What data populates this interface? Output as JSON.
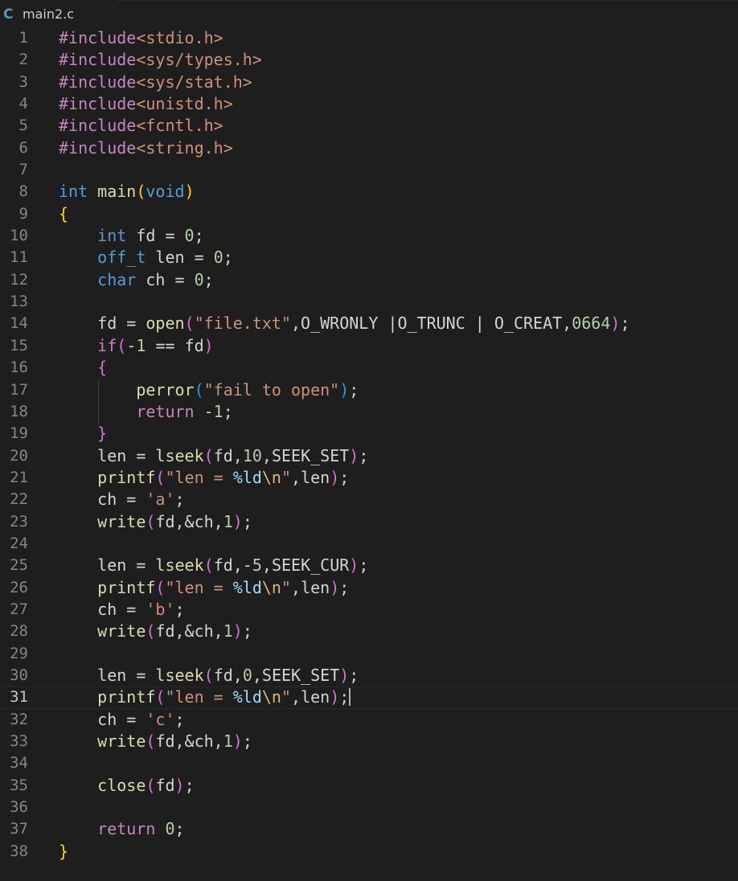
{
  "tab": {
    "icon": "C",
    "filename": "main2.c"
  },
  "editor": {
    "current_line": 31
  },
  "code_lines": [
    {
      "n": "1",
      "tokens": [
        [
          "ctl",
          "#include"
        ],
        [
          "str",
          "<stdio.h>"
        ]
      ]
    },
    {
      "n": "2",
      "tokens": [
        [
          "ctl",
          "#include"
        ],
        [
          "str",
          "<sys/types.h>"
        ]
      ]
    },
    {
      "n": "3",
      "tokens": [
        [
          "ctl",
          "#include"
        ],
        [
          "str",
          "<sys/stat.h>"
        ]
      ]
    },
    {
      "n": "4",
      "tokens": [
        [
          "ctl",
          "#include"
        ],
        [
          "str",
          "<unistd.h>"
        ]
      ]
    },
    {
      "n": "5",
      "tokens": [
        [
          "ctl",
          "#include"
        ],
        [
          "str",
          "<fcntl.h>"
        ]
      ]
    },
    {
      "n": "6",
      "tokens": [
        [
          "ctl",
          "#include"
        ],
        [
          "str",
          "<string.h>"
        ]
      ]
    },
    {
      "n": "7",
      "tokens": []
    },
    {
      "n": "8",
      "tokens": [
        [
          "kw",
          "int"
        ],
        [
          "p",
          " "
        ],
        [
          "fn",
          "main"
        ],
        [
          "br1",
          "("
        ],
        [
          "kw",
          "void"
        ],
        [
          "br1",
          ")"
        ]
      ]
    },
    {
      "n": "9",
      "tokens": [
        [
          "br1",
          "{"
        ]
      ]
    },
    {
      "n": "10",
      "tokens": [
        [
          "p",
          "    "
        ],
        [
          "kw",
          "int"
        ],
        [
          "p",
          " fd = "
        ],
        [
          "num",
          "0"
        ],
        [
          "p",
          ";"
        ]
      ]
    },
    {
      "n": "11",
      "tokens": [
        [
          "p",
          "    "
        ],
        [
          "kw",
          "off_t"
        ],
        [
          "p",
          " len = "
        ],
        [
          "num",
          "0"
        ],
        [
          "p",
          ";"
        ]
      ]
    },
    {
      "n": "12",
      "tokens": [
        [
          "p",
          "    "
        ],
        [
          "kw",
          "char"
        ],
        [
          "p",
          " ch = "
        ],
        [
          "num",
          "0"
        ],
        [
          "p",
          ";"
        ]
      ]
    },
    {
      "n": "13",
      "tokens": []
    },
    {
      "n": "14",
      "tokens": [
        [
          "p",
          "    fd = "
        ],
        [
          "fn",
          "open"
        ],
        [
          "br2",
          "("
        ],
        [
          "str",
          "\"file.txt\""
        ],
        [
          "p",
          ",O_WRONLY |O_TRUNC | O_CREAT,"
        ],
        [
          "num",
          "0664"
        ],
        [
          "br2",
          ")"
        ],
        [
          "p",
          ";"
        ]
      ]
    },
    {
      "n": "15",
      "tokens": [
        [
          "p",
          "    "
        ],
        [
          "ctl",
          "if"
        ],
        [
          "br2",
          "("
        ],
        [
          "p",
          "-"
        ],
        [
          "num",
          "1"
        ],
        [
          "p",
          " == fd"
        ],
        [
          "br2",
          ")"
        ]
      ]
    },
    {
      "n": "16",
      "tokens": [
        [
          "p",
          "    "
        ],
        [
          "br2",
          "{"
        ]
      ]
    },
    {
      "n": "17",
      "tokens": [
        [
          "p",
          "        "
        ],
        [
          "fn",
          "perror"
        ],
        [
          "br3",
          "("
        ],
        [
          "str",
          "\"fail to open\""
        ],
        [
          "br3",
          ")"
        ],
        [
          "p",
          ";"
        ]
      ]
    },
    {
      "n": "18",
      "tokens": [
        [
          "p",
          "        "
        ],
        [
          "ctl",
          "return"
        ],
        [
          "p",
          " -"
        ],
        [
          "num",
          "1"
        ],
        [
          "p",
          ";"
        ]
      ]
    },
    {
      "n": "19",
      "tokens": [
        [
          "p",
          "    "
        ],
        [
          "br2",
          "}"
        ]
      ]
    },
    {
      "n": "20",
      "tokens": [
        [
          "p",
          "    len = "
        ],
        [
          "fn",
          "lseek"
        ],
        [
          "br2",
          "("
        ],
        [
          "p",
          "fd,"
        ],
        [
          "num",
          "10"
        ],
        [
          "p",
          ",SEEK_SET"
        ],
        [
          "br2",
          ")"
        ],
        [
          "p",
          ";"
        ]
      ]
    },
    {
      "n": "21",
      "tokens": [
        [
          "p",
          "    "
        ],
        [
          "fn",
          "printf"
        ],
        [
          "br2",
          "("
        ],
        [
          "str",
          "\"len = "
        ],
        [
          "fmt",
          "%ld"
        ],
        [
          "esc",
          "\\n"
        ],
        [
          "str",
          "\""
        ],
        [
          "p",
          ",len"
        ],
        [
          "br2",
          ")"
        ],
        [
          "p",
          ";"
        ]
      ]
    },
    {
      "n": "22",
      "tokens": [
        [
          "p",
          "    ch = "
        ],
        [
          "str",
          "'a'"
        ],
        [
          "p",
          ";"
        ]
      ]
    },
    {
      "n": "23",
      "tokens": [
        [
          "p",
          "    "
        ],
        [
          "fn",
          "write"
        ],
        [
          "br2",
          "("
        ],
        [
          "p",
          "fd,&ch,"
        ],
        [
          "num",
          "1"
        ],
        [
          "br2",
          ")"
        ],
        [
          "p",
          ";"
        ]
      ]
    },
    {
      "n": "24",
      "tokens": []
    },
    {
      "n": "25",
      "tokens": [
        [
          "p",
          "    len = "
        ],
        [
          "fn",
          "lseek"
        ],
        [
          "br2",
          "("
        ],
        [
          "p",
          "fd,-"
        ],
        [
          "num",
          "5"
        ],
        [
          "p",
          ",SEEK_CUR"
        ],
        [
          "br2",
          ")"
        ],
        [
          "p",
          ";"
        ]
      ]
    },
    {
      "n": "26",
      "tokens": [
        [
          "p",
          "    "
        ],
        [
          "fn",
          "printf"
        ],
        [
          "br2",
          "("
        ],
        [
          "str",
          "\"len = "
        ],
        [
          "fmt",
          "%ld"
        ],
        [
          "esc",
          "\\n"
        ],
        [
          "str",
          "\""
        ],
        [
          "p",
          ",len"
        ],
        [
          "br2",
          ")"
        ],
        [
          "p",
          ";"
        ]
      ]
    },
    {
      "n": "27",
      "tokens": [
        [
          "p",
          "    ch = "
        ],
        [
          "str",
          "'b'"
        ],
        [
          "p",
          ";"
        ]
      ]
    },
    {
      "n": "28",
      "tokens": [
        [
          "p",
          "    "
        ],
        [
          "fn",
          "write"
        ],
        [
          "br2",
          "("
        ],
        [
          "p",
          "fd,&ch,"
        ],
        [
          "num",
          "1"
        ],
        [
          "br2",
          ")"
        ],
        [
          "p",
          ";"
        ]
      ]
    },
    {
      "n": "29",
      "tokens": []
    },
    {
      "n": "30",
      "tokens": [
        [
          "p",
          "    len = "
        ],
        [
          "fn",
          "lseek"
        ],
        [
          "br2",
          "("
        ],
        [
          "p",
          "fd,"
        ],
        [
          "num",
          "0"
        ],
        [
          "p",
          ",SEEK_SET"
        ],
        [
          "br2",
          ")"
        ],
        [
          "p",
          ";"
        ]
      ]
    },
    {
      "n": "31",
      "tokens": [
        [
          "p",
          "    "
        ],
        [
          "fn",
          "printf"
        ],
        [
          "br2",
          "("
        ],
        [
          "str",
          "\"len = "
        ],
        [
          "fmt",
          "%ld"
        ],
        [
          "esc",
          "\\n"
        ],
        [
          "str",
          "\""
        ],
        [
          "p",
          ",len"
        ],
        [
          "br2",
          ")"
        ],
        [
          "p",
          ";"
        ],
        [
          "cursor",
          ""
        ]
      ]
    },
    {
      "n": "32",
      "tokens": [
        [
          "p",
          "    ch = "
        ],
        [
          "str",
          "'c'"
        ],
        [
          "p",
          ";"
        ]
      ]
    },
    {
      "n": "33",
      "tokens": [
        [
          "p",
          "    "
        ],
        [
          "fn",
          "write"
        ],
        [
          "br2",
          "("
        ],
        [
          "p",
          "fd,&ch,"
        ],
        [
          "num",
          "1"
        ],
        [
          "br2",
          ")"
        ],
        [
          "p",
          ";"
        ]
      ]
    },
    {
      "n": "34",
      "tokens": []
    },
    {
      "n": "35",
      "tokens": [
        [
          "p",
          "    "
        ],
        [
          "fn",
          "close"
        ],
        [
          "br2",
          "("
        ],
        [
          "p",
          "fd"
        ],
        [
          "br2",
          ")"
        ],
        [
          "p",
          ";"
        ]
      ]
    },
    {
      "n": "36",
      "tokens": []
    },
    {
      "n": "37",
      "tokens": [
        [
          "p",
          "    "
        ],
        [
          "ctl",
          "return"
        ],
        [
          "p",
          " "
        ],
        [
          "num",
          "0"
        ],
        [
          "p",
          ";"
        ]
      ]
    },
    {
      "n": "38",
      "tokens": [
        [
          "br1",
          "}"
        ]
      ]
    }
  ]
}
